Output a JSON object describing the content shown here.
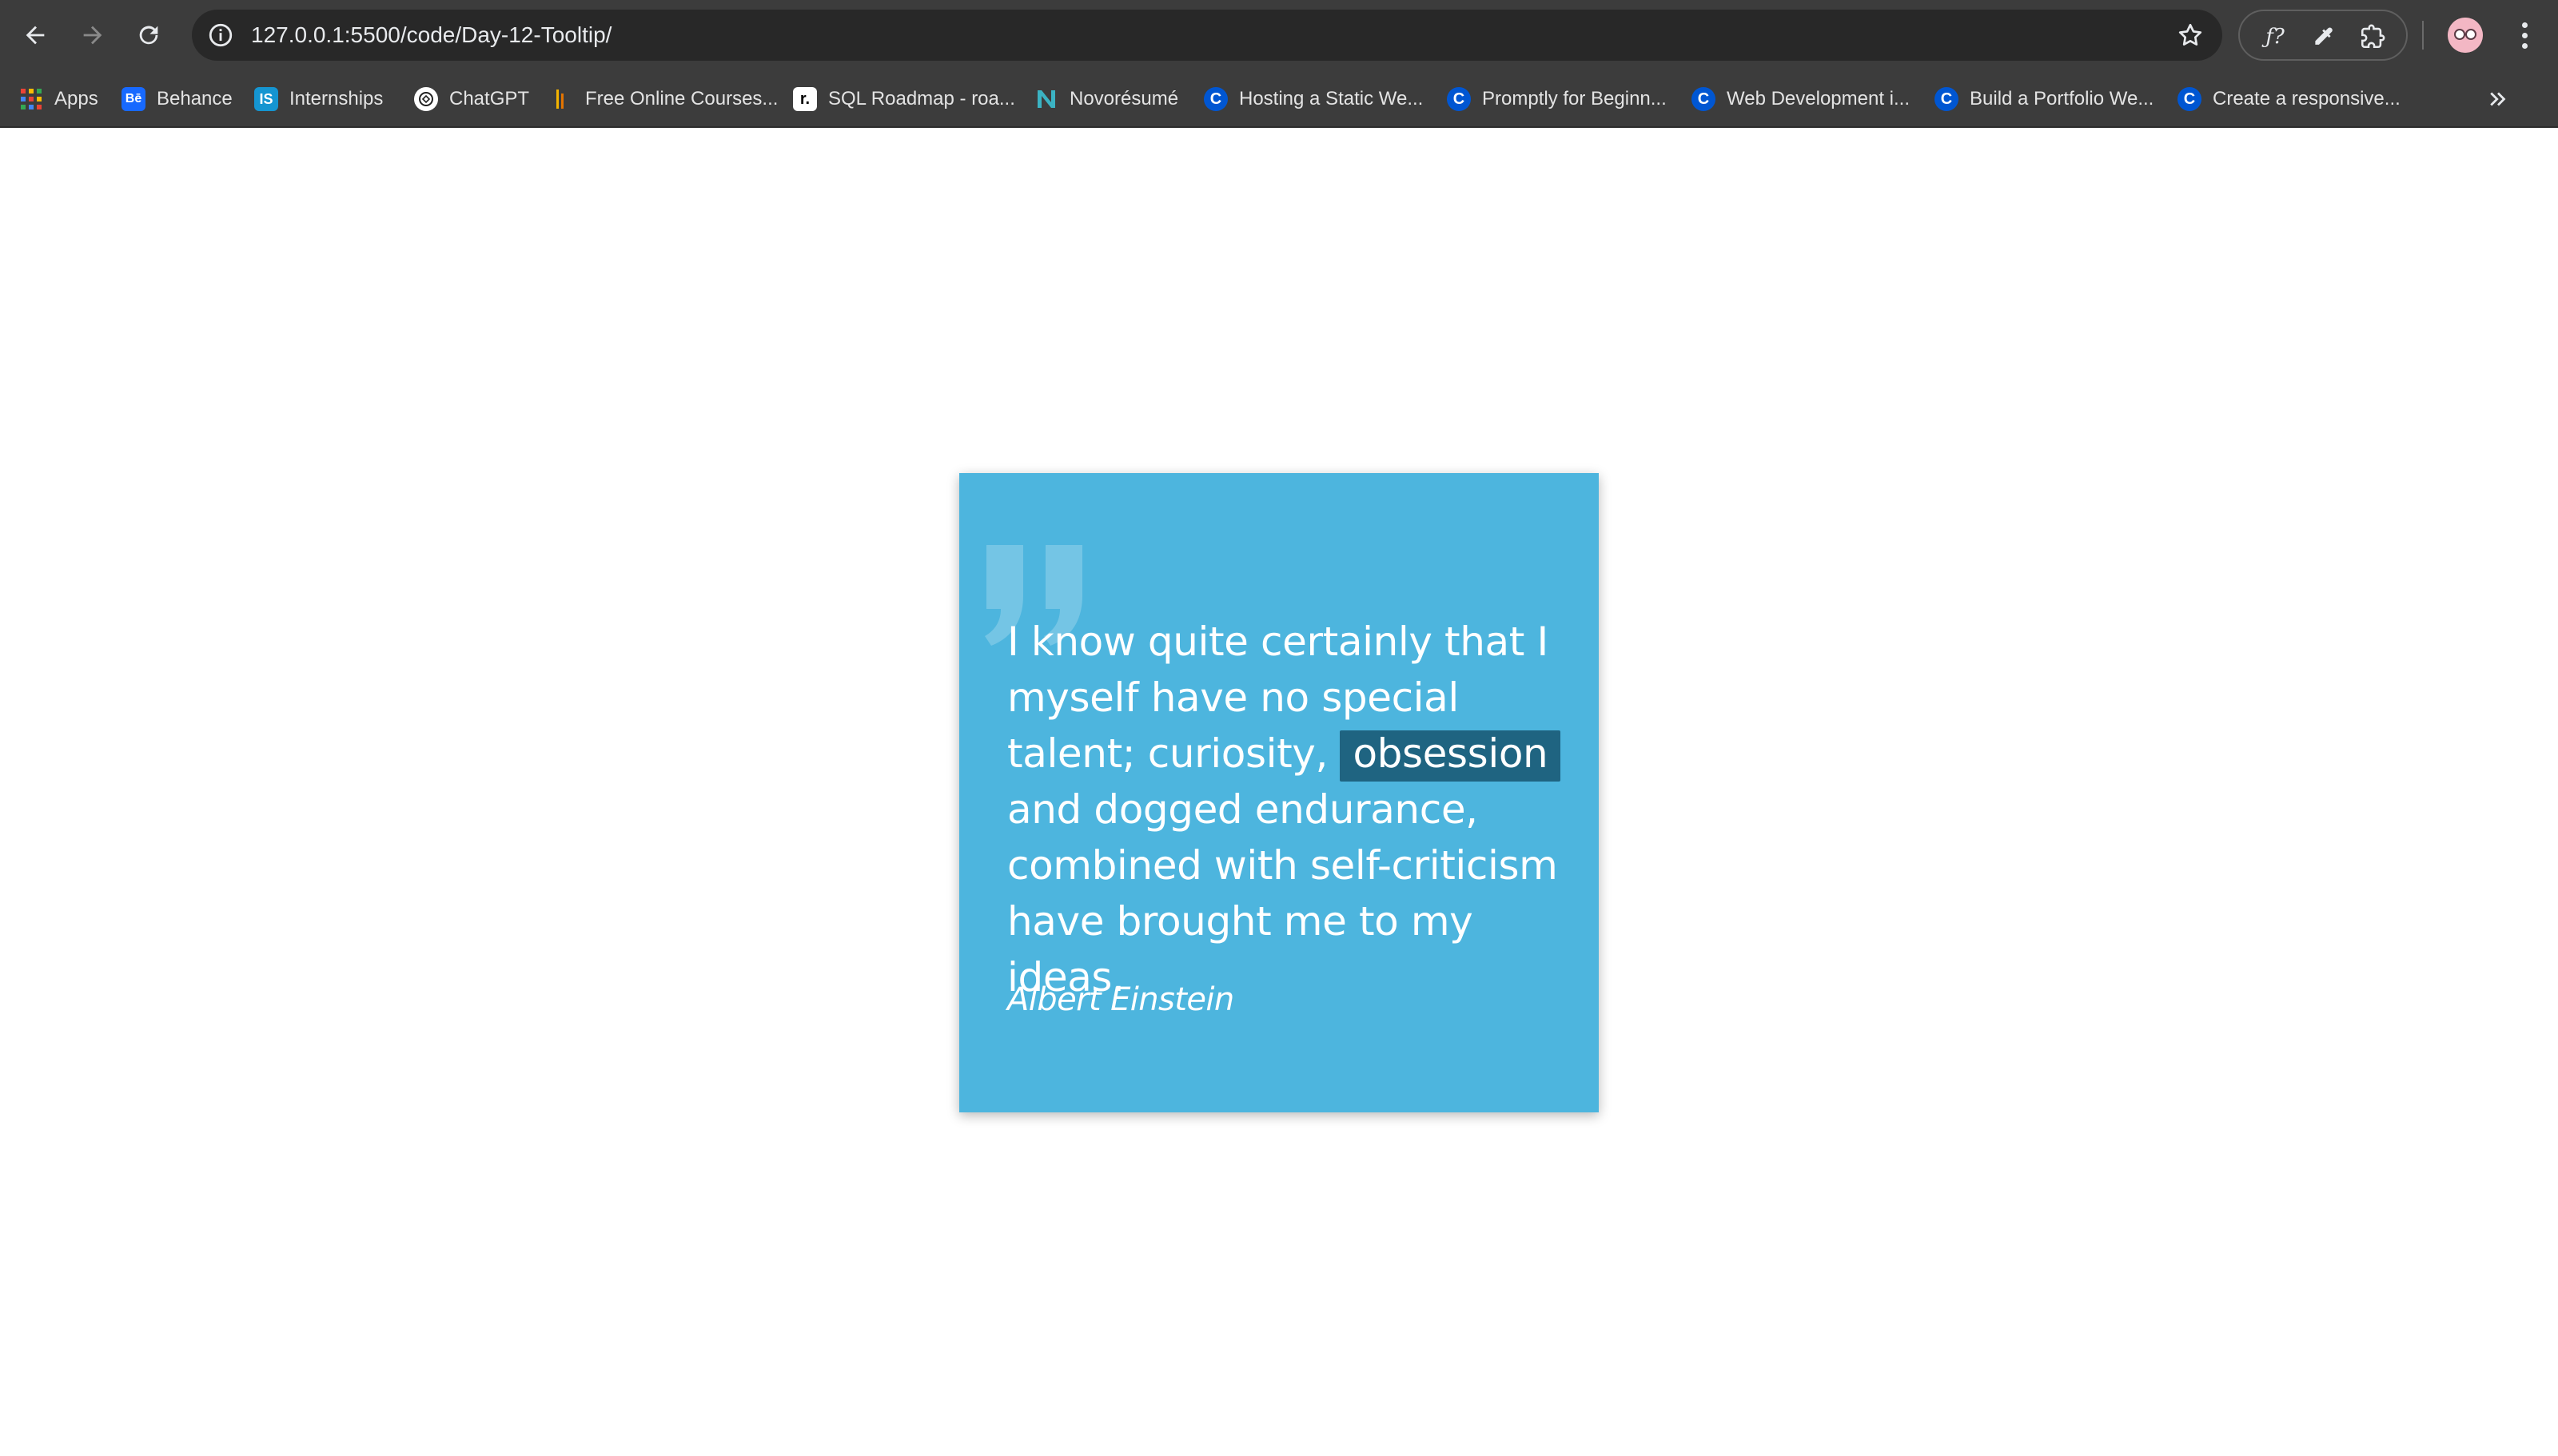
{
  "browser": {
    "url": "127.0.0.1:5500/code/Day-12-Tooltip/",
    "bookmarks": [
      {
        "label": "Apps",
        "icon": "apps-grid-icon"
      },
      {
        "label": "Behance",
        "icon": "behance-icon"
      },
      {
        "label": "Internships",
        "icon": "internshala-icon"
      },
      {
        "label": "ChatGPT",
        "icon": "chatgpt-icon"
      },
      {
        "label": "Free Online Courses...",
        "icon": "courses-icon"
      },
      {
        "label": "SQL Roadmap - roa...",
        "icon": "roadmap-icon"
      },
      {
        "label": "Novorésumé",
        "icon": "novoresume-icon"
      },
      {
        "label": "Hosting a Static We...",
        "icon": "coursera-icon"
      },
      {
        "label": "Promptly for Beginn...",
        "icon": "coursera-icon"
      },
      {
        "label": "Web Development i...",
        "icon": "coursera-icon"
      },
      {
        "label": "Build a Portfolio We...",
        "icon": "coursera-icon"
      },
      {
        "label": "Create a responsive...",
        "icon": "coursera-icon"
      }
    ],
    "colors": {
      "chrome": "#3c3c3c",
      "omnibox": "#282828",
      "text": "#e3e3e3"
    }
  },
  "quote": {
    "line_before": "I know quite certainly that I myself have no special talent; curiosity,",
    "highlight": "obsession",
    "line_after": "and dogged endurance, combined with self-criticism have brought me to my ideas.",
    "author": "Albert Einstein",
    "colors": {
      "card": "#4db5de",
      "highlight": "#1f6481",
      "text": "#ffffff"
    }
  }
}
